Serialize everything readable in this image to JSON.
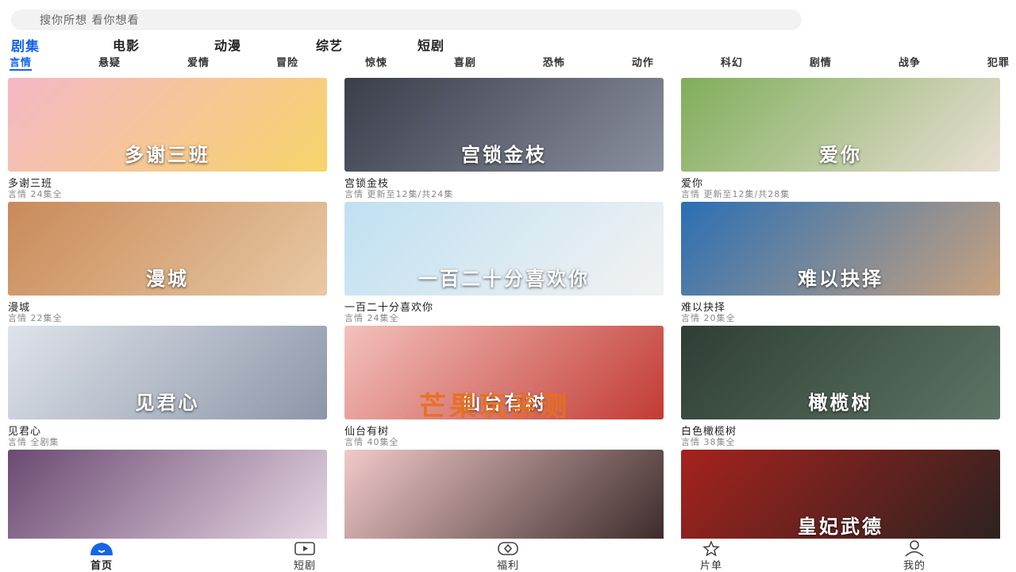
{
  "search": {
    "placeholder": "搜你所想 看你想看"
  },
  "categories": [
    "剧集",
    "电影",
    "动漫",
    "综艺",
    "短剧"
  ],
  "genres": [
    "言情",
    "悬疑",
    "爱情",
    "冒险",
    "惊悚",
    "喜剧",
    "恐怖",
    "动作",
    "科幻",
    "剧情",
    "战争",
    "犯罪"
  ],
  "cards": [
    {
      "title": "多谢三班",
      "meta": "言情  24集全",
      "poster_text": "多谢三班",
      "colors": [
        "#f4b8c6",
        "#f7d46a"
      ]
    },
    {
      "title": "宫锁金枝",
      "meta": "言情  更新至12集/共24集",
      "poster_text": "宫锁金枝",
      "colors": [
        "#3a3d4a",
        "#8a8f9e"
      ]
    },
    {
      "title": "爱你",
      "meta": "言情  更新至12集/共28集",
      "poster_text": "爱你",
      "colors": [
        "#7fae5a",
        "#e9dfd4"
      ]
    },
    {
      "title": "漫城",
      "meta": "言情  22集全",
      "poster_text": "漫城",
      "colors": [
        "#c98a5a",
        "#e8c9a4"
      ]
    },
    {
      "title": "一百二十分喜欢你",
      "meta": "言情  24集全",
      "poster_text": "一百二十分喜欢你",
      "colors": [
        "#bfe0f2",
        "#f2f2f2"
      ]
    },
    {
      "title": "难以抉择",
      "meta": "言情  20集全",
      "poster_text": "难以抉择",
      "colors": [
        "#2a6fb5",
        "#c9a27e"
      ]
    },
    {
      "title": "见君心",
      "meta": "言情  全剧集",
      "poster_text": "见君心",
      "colors": [
        "#dfe3ea",
        "#8c96a8"
      ]
    },
    {
      "title": "仙台有树",
      "meta": "言情  40集全",
      "poster_text": "仙台有树",
      "colors": [
        "#f3c1bc",
        "#c23b34"
      ]
    },
    {
      "title": "白色橄榄树",
      "meta": "言情  38集全",
      "poster_text": "橄榄树",
      "colors": [
        "#2f3e34",
        "#5d7465"
      ]
    },
    {
      "title": "",
      "meta": "",
      "poster_text": "",
      "colors": [
        "#6b4a72",
        "#e8d8e4"
      ]
    },
    {
      "title": "",
      "meta": "",
      "poster_text": "",
      "colors": [
        "#f2c9c9",
        "#3b2a2a"
      ]
    },
    {
      "title": "",
      "meta": "",
      "poster_text": "皇妃武德",
      "colors": [
        "#a6221d",
        "#2b2220"
      ]
    }
  ],
  "watermark": "芒果玩亲测",
  "nav": [
    {
      "label": "首页",
      "icon": "home-icon"
    },
    {
      "label": "短剧",
      "icon": "play-icon"
    },
    {
      "label": "福利",
      "icon": "gift-icon"
    },
    {
      "label": "片单",
      "icon": "star-icon"
    },
    {
      "label": "我的",
      "icon": "user-icon"
    }
  ],
  "accent_color": "#1565e8"
}
